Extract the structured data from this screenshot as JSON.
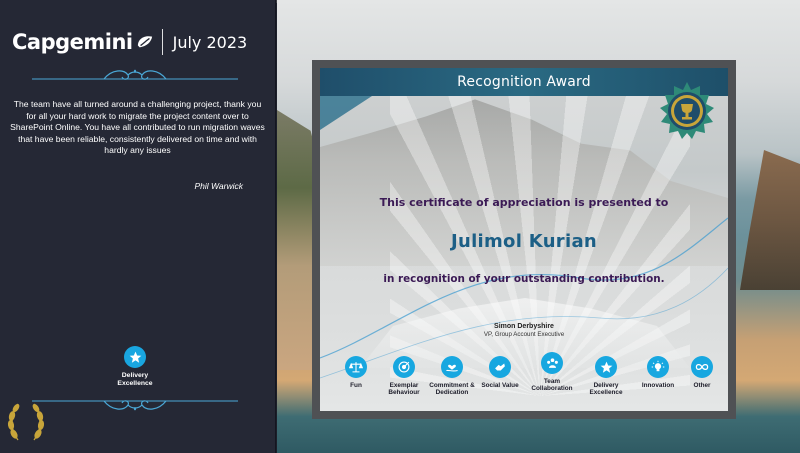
{
  "brand": {
    "logo_text": "Capgemini",
    "date": "July 2023"
  },
  "message": {
    "text": "The team have all turned around a challenging project, thank you for all your hard work to migrate the project content over to SharePoint Online. You have all contributed to run migration waves that have been reliable, consistently delivered on time and with hardly any issues",
    "author": "Phil Warwick"
  },
  "badge": {
    "label": "Delivery Excellence",
    "icon": "star-icon"
  },
  "certificate": {
    "header": "Recognition Award",
    "presented": "This certificate of  appreciation is  presented to",
    "recipient": "Julimol Kurian",
    "recognition": "in recognition of your outstanding contribution.",
    "signer_name": "Simon Derbyshire",
    "signer_title": "VP, Group Account Executive"
  },
  "values": [
    {
      "label": "Fun",
      "icon": "scales-icon"
    },
    {
      "label": "Exemplar Behaviour",
      "icon": "target-icon"
    },
    {
      "label": "Commitment & Dedication",
      "icon": "hand-heart-icon"
    },
    {
      "label": "Social Value",
      "icon": "hands-icon"
    },
    {
      "label": "Team Collaboration",
      "icon": "team-icon"
    },
    {
      "label": "Delivery Excellence",
      "icon": "star-icon"
    },
    {
      "label": "Innovation",
      "icon": "lightbulb-icon"
    },
    {
      "label": "Other",
      "icon": "infinity-icon"
    }
  ],
  "colors": {
    "panel": "#252835",
    "accent_blue": "#17a7e0",
    "header_teal": "#2a6a83",
    "text_purple": "#3b1a55",
    "recipient_blue": "#1c5f86",
    "ornament": "#4aa7d6",
    "gold": "#c8a53a"
  }
}
